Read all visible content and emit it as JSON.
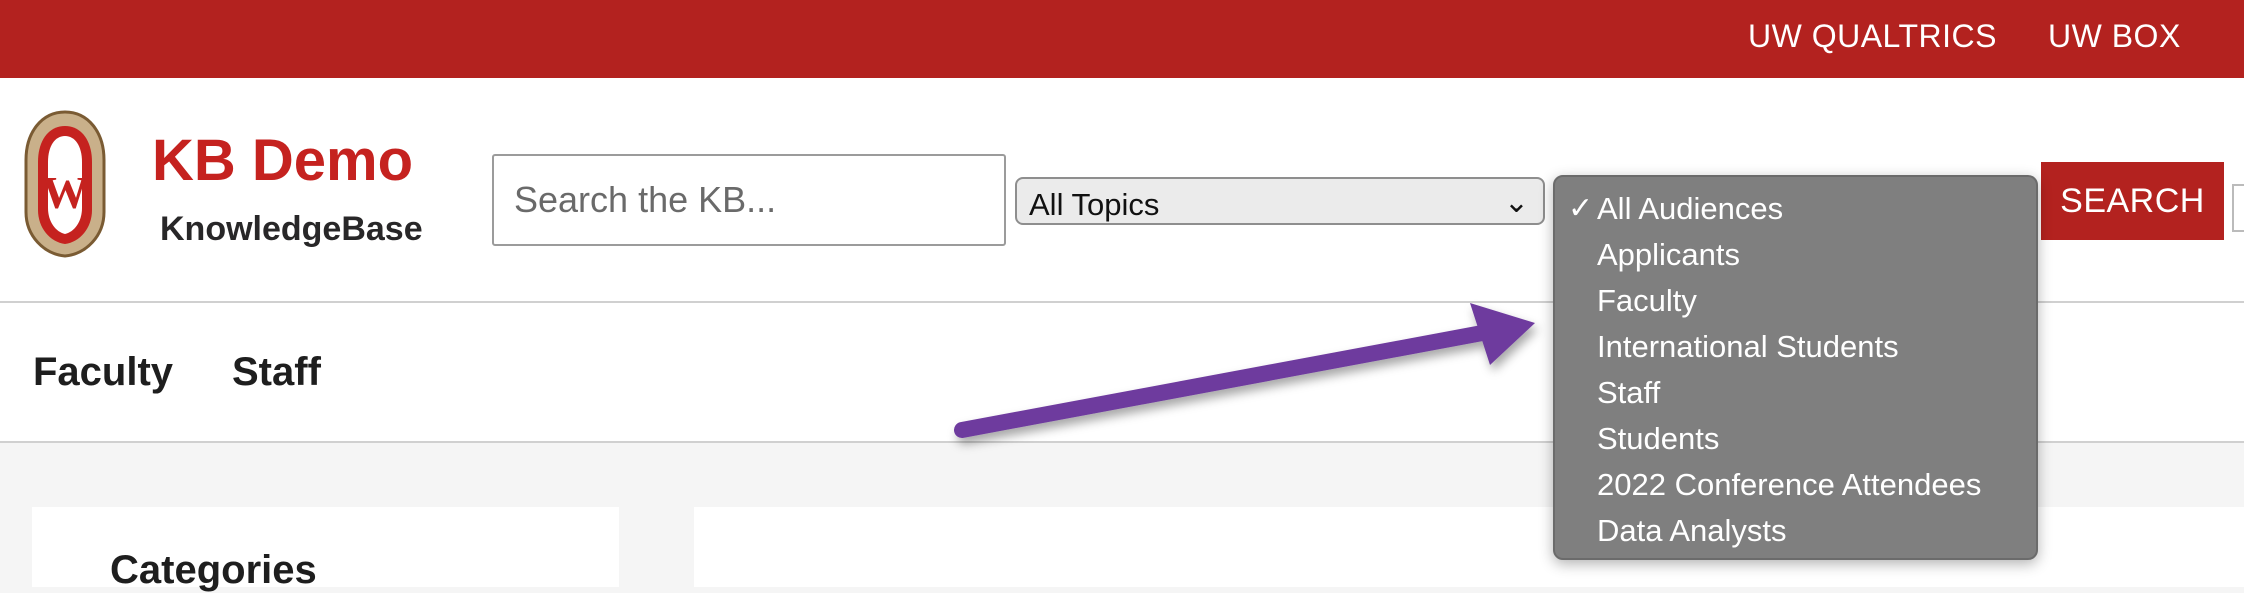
{
  "topbar": {
    "links": [
      "UW QUALTRICS",
      "UW BOX"
    ]
  },
  "brand": {
    "title": "KB Demo",
    "subtitle": "KnowledgeBase"
  },
  "search": {
    "placeholder": "Search the KB...",
    "topic_selected": "All Topics",
    "button_label": "SEARCH"
  },
  "audience_dropdown": {
    "selected": "All Audiences",
    "options": [
      "All Audiences",
      "Applicants",
      "Faculty",
      "International Students",
      "Staff",
      "Students",
      "2022 Conference Attendees",
      "Data Analysts"
    ]
  },
  "nav": {
    "items": [
      "Faculty",
      "Staff"
    ]
  },
  "sidebar": {
    "heading_partial": "Categories"
  },
  "colors": {
    "brand_red": "#b3221f",
    "dropdown_bg": "#7f7f7f",
    "arrow": "#6e3b9e"
  }
}
